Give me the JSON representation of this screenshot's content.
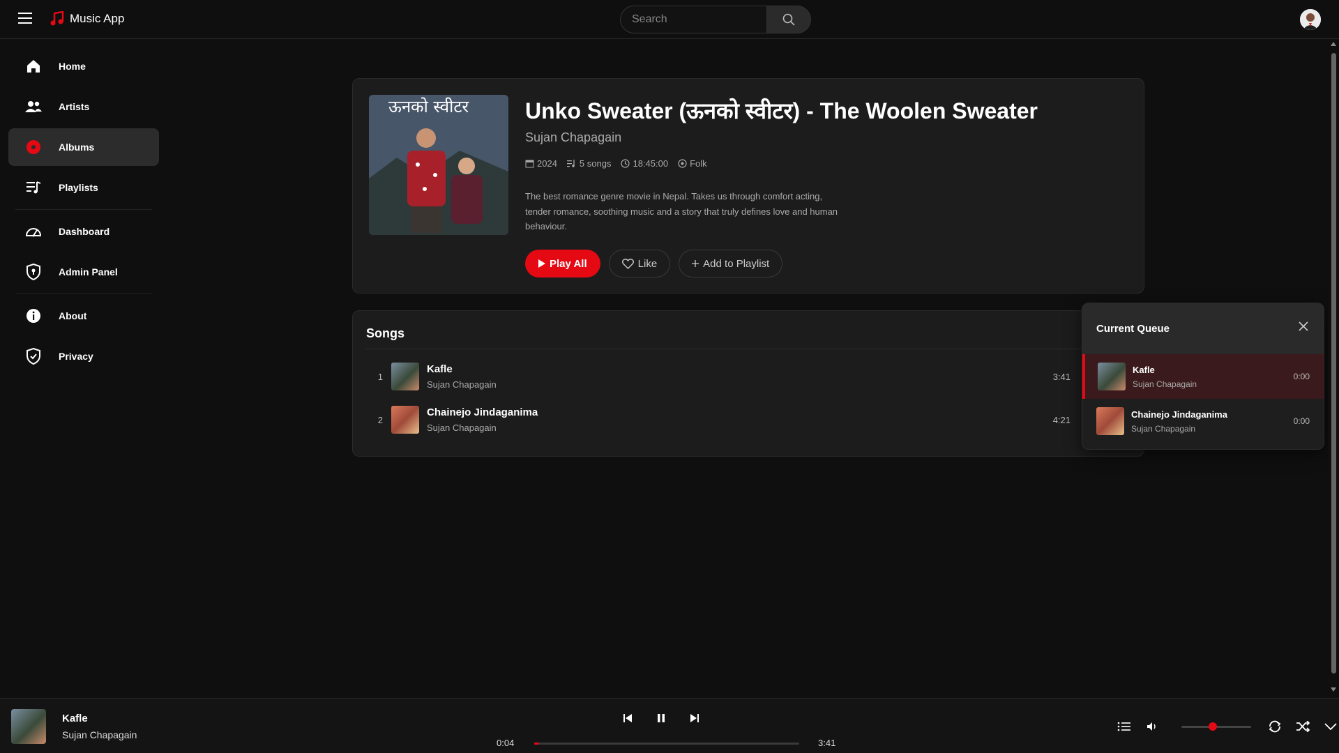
{
  "app": {
    "name": "Music App",
    "accent": "#e50914"
  },
  "search": {
    "placeholder": "Search"
  },
  "sidebar": {
    "items": [
      {
        "label": "Home",
        "icon": "home-icon"
      },
      {
        "label": "Artists",
        "icon": "users-icon"
      },
      {
        "label": "Albums",
        "icon": "album-icon",
        "active": true
      },
      {
        "label": "Playlists",
        "icon": "playlist-icon"
      },
      {
        "label": "Dashboard",
        "icon": "dashboard-icon"
      },
      {
        "label": "Admin Panel",
        "icon": "shield-icon"
      },
      {
        "label": "About",
        "icon": "info-icon"
      },
      {
        "label": "Privacy",
        "icon": "shield-check-icon"
      }
    ]
  },
  "album": {
    "title": "Unko Sweater (ऊनको स्वीटर) - The Woolen Sweater",
    "artist": "Sujan Chapagain",
    "year": "2024",
    "songs_count": "5 songs",
    "duration": "18:45:00",
    "genre": "Folk",
    "description": "The best romance genre movie in Nepal. Takes us through comfort acting, tender romance, soothing music and a story that truly defines love and human behaviour.",
    "cover_text": "ऊनको स्वीटर",
    "actions": {
      "play_all": "Play All",
      "like": "Like",
      "add_to_playlist": "Add to Playlist"
    }
  },
  "songs": {
    "heading": "Songs",
    "rows": [
      {
        "num": "1",
        "title": "Kafle",
        "artist": "Sujan Chapagain",
        "duration": "3:41"
      },
      {
        "num": "2",
        "title": "Chainejo Jindaganima",
        "artist": "Sujan Chapagain",
        "duration": "4:21"
      }
    ]
  },
  "queue": {
    "heading": "Current Queue",
    "items": [
      {
        "title": "Kafle",
        "artist": "Sujan Chapagain",
        "duration": "0:00",
        "active": true
      },
      {
        "title": "Chainejo Jindaganima",
        "artist": "Sujan Chapagain",
        "duration": "0:00"
      }
    ]
  },
  "player": {
    "title": "Kafle",
    "artist": "Sujan Chapagain",
    "current_time": "0:04",
    "total_time": "3:41",
    "progress": 0.018,
    "volume": 0.45
  }
}
